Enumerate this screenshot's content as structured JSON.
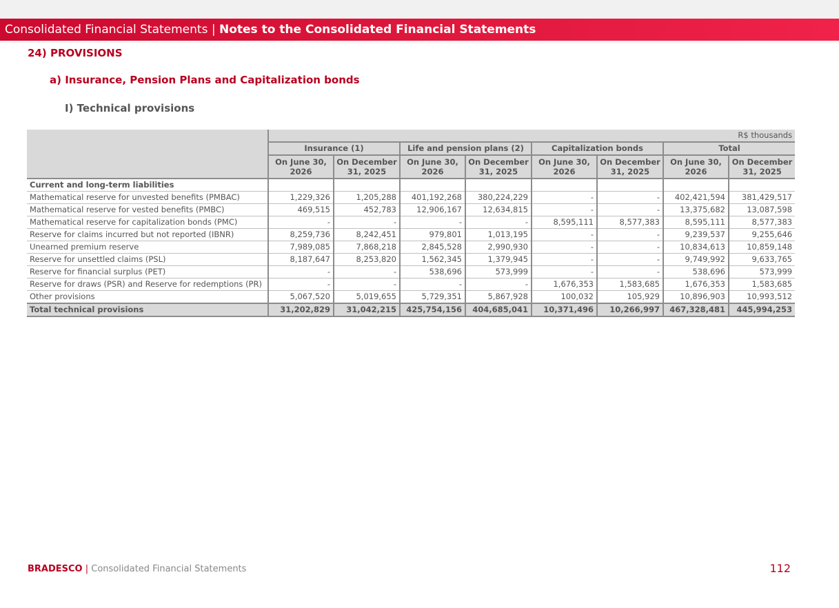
{
  "banner": {
    "part1": "Consolidated Financial Statements | ",
    "part2": "Notes to the Consolidated Financial Statements"
  },
  "headings": {
    "section": "24) PROVISIONS",
    "sub": "a) Insurance, Pension Plans and Capitalization bonds",
    "subsub": "I)  Technical provisions"
  },
  "table": {
    "units": "R$ thousands",
    "groups": [
      "Insurance (1)",
      "Life and pension plans (2)",
      "Capitalization bonds",
      "Total"
    ],
    "col_a": "On June 30, 2026",
    "col_b": "On December 31, 2025",
    "section_label": "Current and long-term liabilities",
    "rows": [
      {
        "label": "Mathematical reserve for unvested benefits (PMBAC)",
        "values": [
          "1,229,326",
          "1,205,288",
          "401,192,268",
          "380,224,229",
          "-",
          "-",
          "402,421,594",
          "381,429,517"
        ]
      },
      {
        "label": "Mathematical reserve for vested benefits (PMBC)",
        "values": [
          "469,515",
          "452,783",
          "12,906,167",
          "12,634,815",
          "-",
          "-",
          "13,375,682",
          "13,087,598"
        ]
      },
      {
        "label": "Mathematical reserve for capitalization bonds (PMC)",
        "values": [
          "-",
          "-",
          "-",
          "-",
          "8,595,111",
          "8,577,383",
          "8,595,111",
          "8,577,383"
        ]
      },
      {
        "label": "Reserve for claims incurred but not reported (IBNR)",
        "values": [
          "8,259,736",
          "8,242,451",
          "979,801",
          "1,013,195",
          "-",
          "-",
          "9,239,537",
          "9,255,646"
        ]
      },
      {
        "label": "Unearned premium reserve",
        "values": [
          "7,989,085",
          "7,868,218",
          "2,845,528",
          "2,990,930",
          "-",
          "-",
          "10,834,613",
          "10,859,148"
        ]
      },
      {
        "label": "Reserve for unsettled claims (PSL)",
        "values": [
          "8,187,647",
          "8,253,820",
          "1,562,345",
          "1,379,945",
          "-",
          "-",
          "9,749,992",
          "9,633,765"
        ]
      },
      {
        "label": "Reserve for financial surplus (PET)",
        "values": [
          "-",
          "-",
          "538,696",
          "573,999",
          "-",
          "-",
          "538,696",
          "573,999"
        ]
      },
      {
        "label": "Reserve for draws (PSR) and Reserve for redemptions (PR)",
        "values": [
          "-",
          "-",
          "-",
          "-",
          "1,676,353",
          "1,583,685",
          "1,676,353",
          "1,583,685"
        ]
      },
      {
        "label": "Other provisions",
        "values": [
          "5,067,520",
          "5,019,655",
          "5,729,351",
          "5,867,928",
          "100,032",
          "105,929",
          "10,896,903",
          "10,993,512"
        ]
      }
    ],
    "total": {
      "label": "Total technical provisions",
      "values": [
        "31,202,829",
        "31,042,215",
        "425,754,156",
        "404,685,041",
        "10,371,496",
        "10,266,997",
        "467,328,481",
        "445,994,253"
      ]
    }
  },
  "footer": {
    "brand": "BRADESCO",
    "separator": " | ",
    "text": "Consolidated Financial Statements",
    "page": "112"
  },
  "colors": {
    "brand_red": "#cc092f",
    "header_gray": "#d9d9d9"
  }
}
